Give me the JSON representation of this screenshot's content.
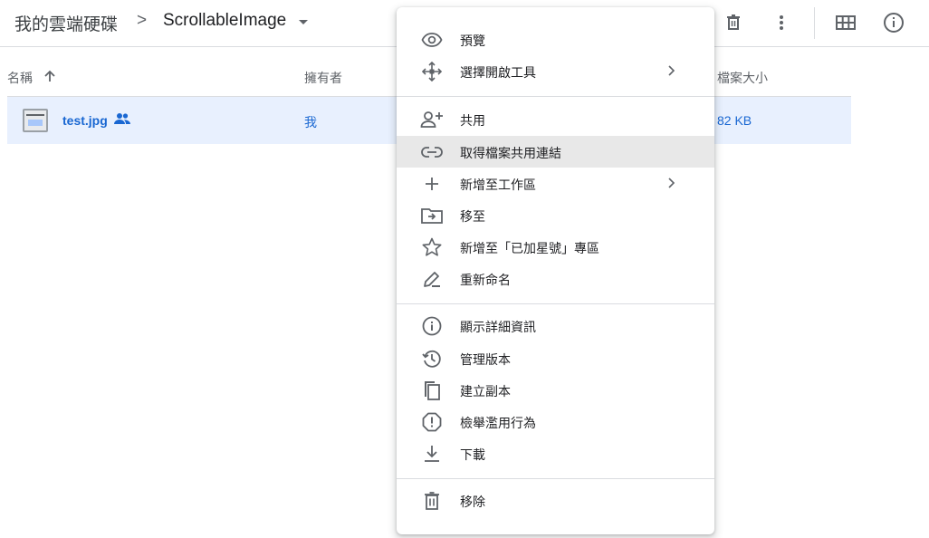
{
  "breadcrumb": {
    "root": "我的雲端硬碟",
    "separator": ">",
    "current": "ScrollableImage"
  },
  "toolbar": {
    "icons": [
      "trash-icon",
      "more-vert-icon",
      "grid-view-icon",
      "info-icon"
    ]
  },
  "table": {
    "columns": {
      "name": "名稱",
      "owner": "擁有者",
      "size": "檔案大小"
    },
    "sort": "arrow-up-icon",
    "rows": [
      {
        "name": "test.jpg",
        "owner": "我",
        "size": "82 KB",
        "shared": true
      }
    ]
  },
  "context_menu": {
    "items": [
      {
        "label": "預覽",
        "icon": "eye-icon"
      },
      {
        "label": "選擇開啟工具",
        "icon": "move-arrows-icon",
        "submenu": true
      },
      {
        "label": "共用",
        "icon": "person-add-icon"
      },
      {
        "label": "取得檔案共用連結",
        "icon": "link-icon",
        "highlighted": true
      },
      {
        "label": "新增至工作區",
        "icon": "plus-icon",
        "submenu": true
      },
      {
        "label": "移至",
        "icon": "folder-move-icon"
      },
      {
        "label": "新增至「已加星號」專區",
        "icon": "star-icon"
      },
      {
        "label": "重新命名",
        "icon": "pencil-icon"
      },
      {
        "label": "顯示詳細資訊",
        "icon": "info-icon"
      },
      {
        "label": "管理版本",
        "icon": "history-icon"
      },
      {
        "label": "建立副本",
        "icon": "copy-icon"
      },
      {
        "label": "檢舉濫用行為",
        "icon": "report-icon"
      },
      {
        "label": "下載",
        "icon": "download-icon"
      },
      {
        "label": "移除",
        "icon": "trash-icon"
      }
    ]
  },
  "colors": {
    "selected_row": "#e8f0fe",
    "link_blue": "#1967d2",
    "menu_highlight": "#e8e8e8",
    "divider": "#dadce0",
    "icon_gray": "#5f6368"
  }
}
